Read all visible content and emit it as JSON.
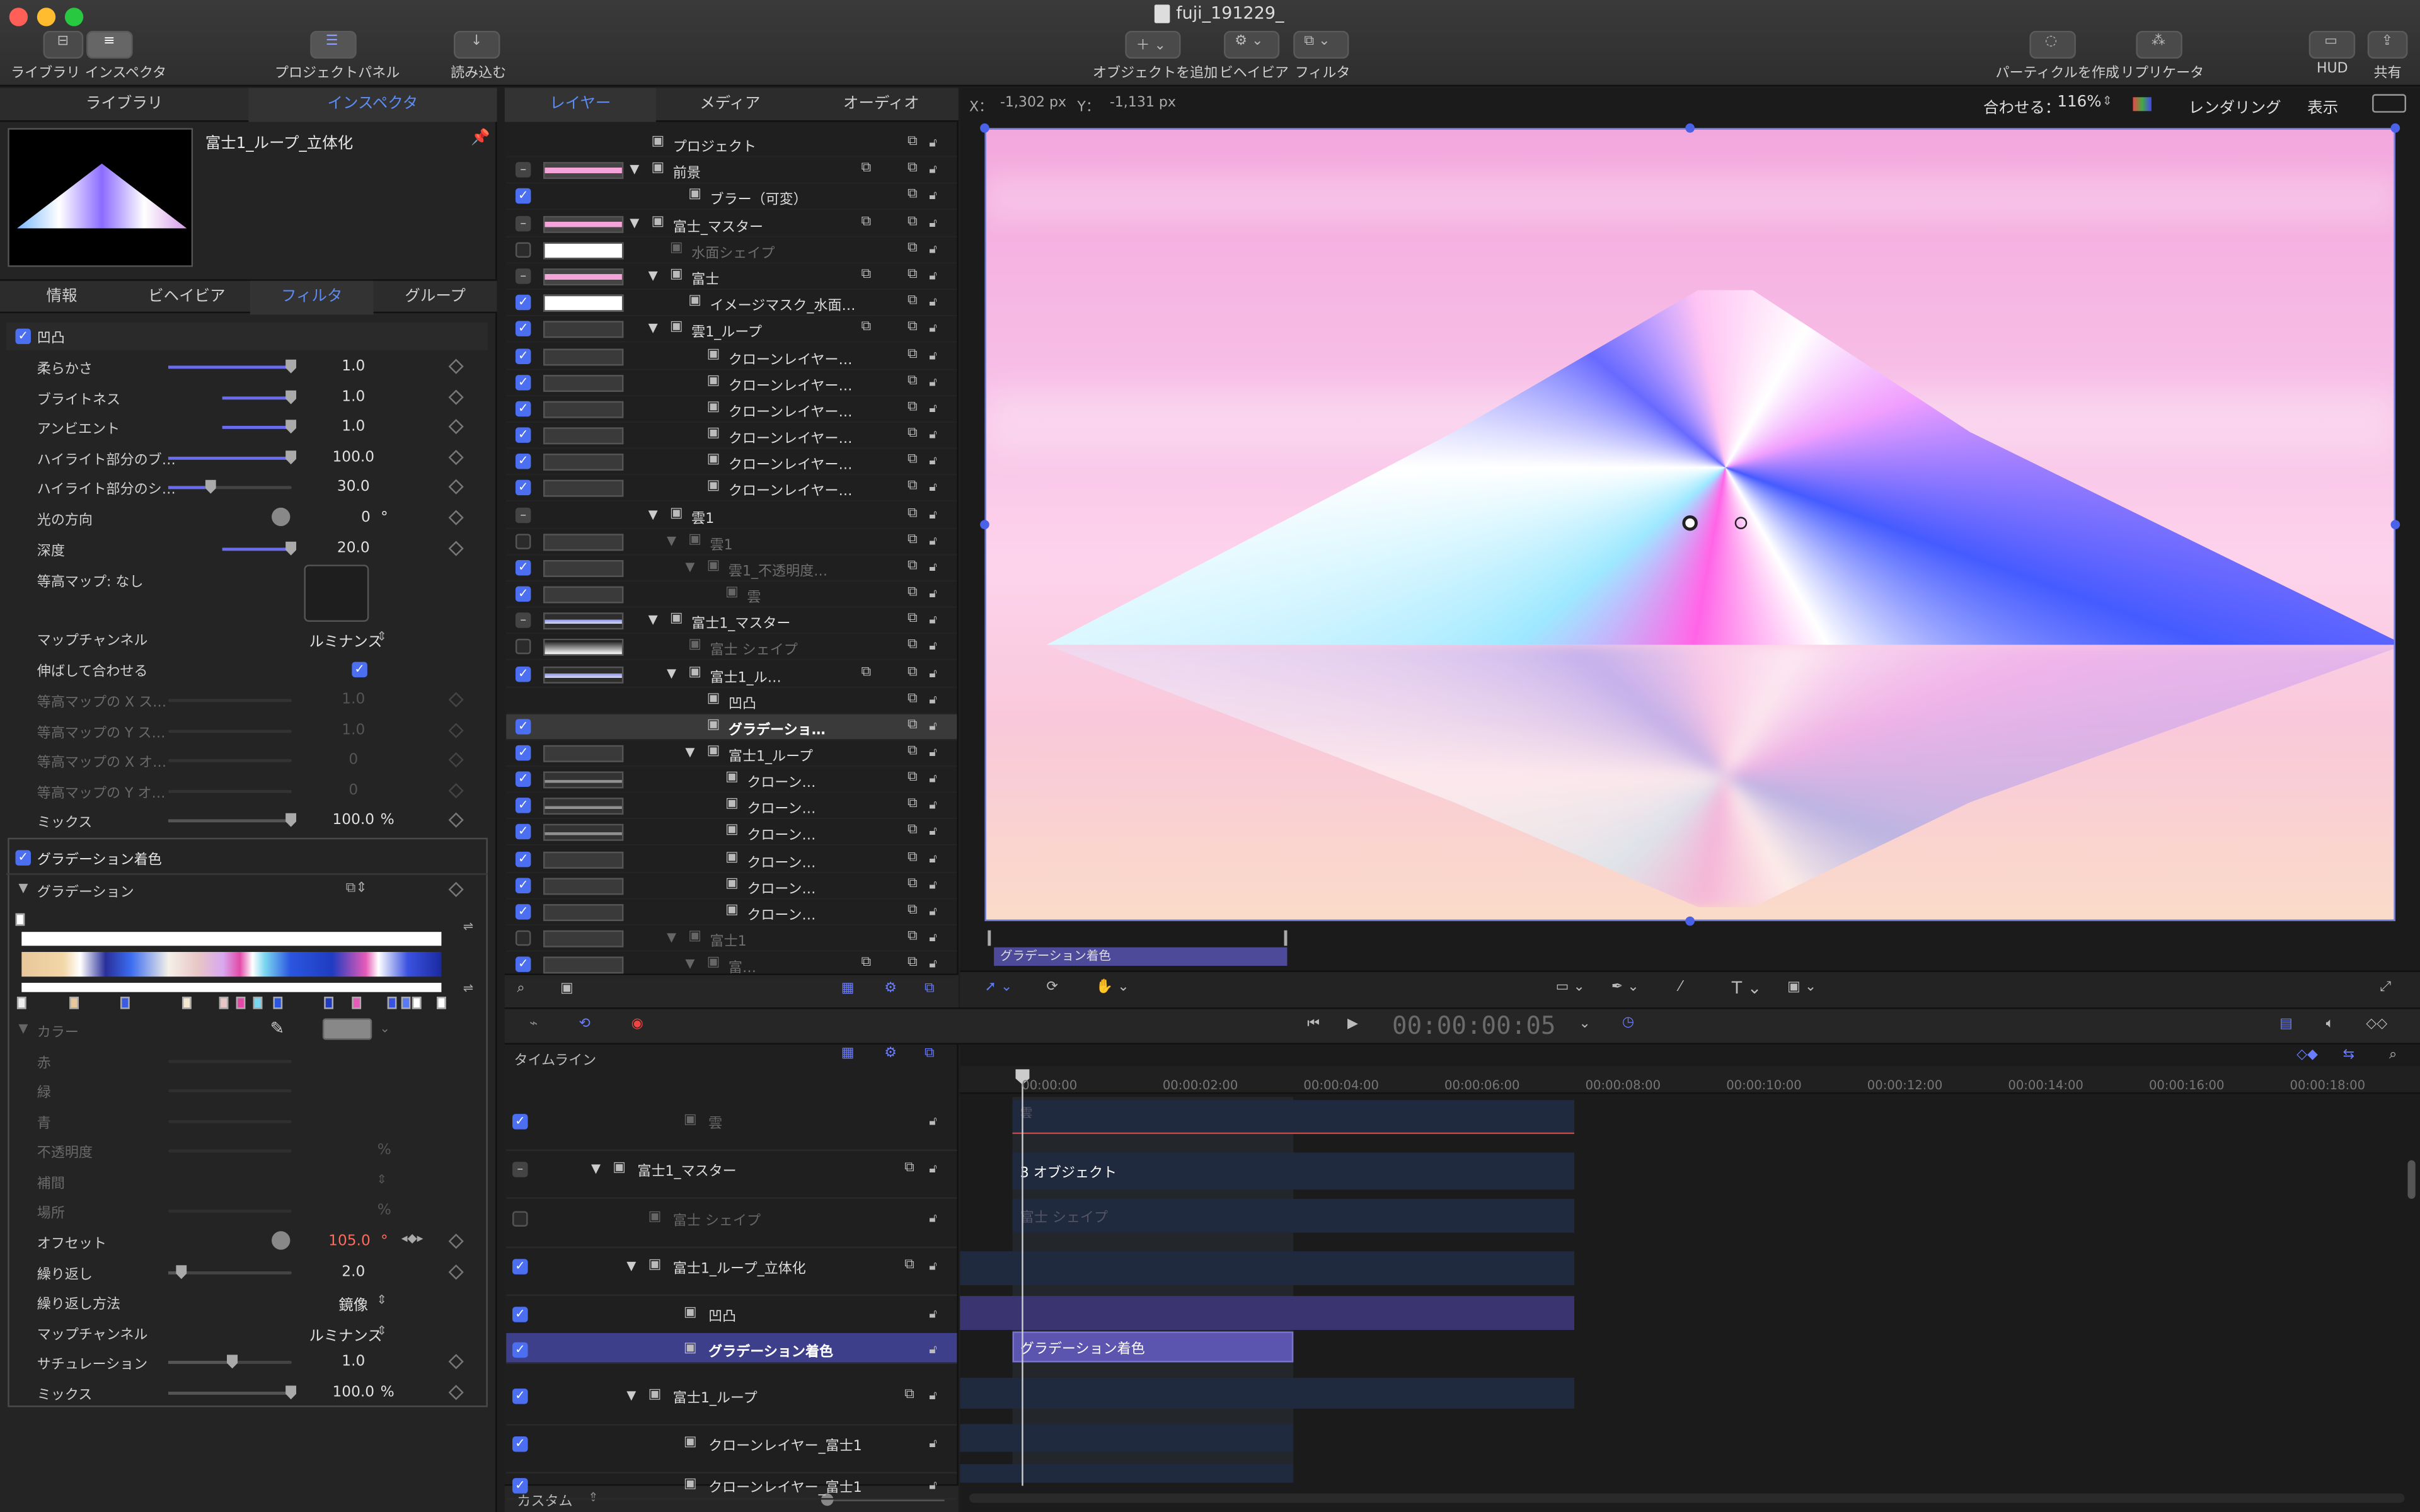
{
  "window": {
    "title": "fuji_191229_"
  },
  "toolbar": {
    "library": "ライブラリ",
    "inspector": "インスペクタ",
    "project_panel": "プロジェクトパネル",
    "import": "読み込む",
    "add_object": "オブジェクトを追加",
    "behaviors": "ビヘイビア",
    "filters": "フィルタ",
    "make_particles": "パーティクルを作成",
    "replicator": "リプリケータ",
    "hud": "HUD",
    "share": "共有"
  },
  "left_tabs": {
    "library": "ライブラリ",
    "inspector": "インスペクタ"
  },
  "preview": {
    "name": "富士1_ループ_立体化"
  },
  "inspector_tabs": [
    "情報",
    "ビヘイビア",
    "フィルタ",
    "グループ"
  ],
  "filter1": {
    "name": "凹凸",
    "params": [
      {
        "label": "柔らかさ",
        "value": "1.0"
      },
      {
        "label": "ブライトネス",
        "value": "1.0"
      },
      {
        "label": "アンビエント",
        "value": "1.0"
      },
      {
        "label": "ハイライト部分のブ…",
        "value": "100.0"
      },
      {
        "label": "ハイライト部分のシ…",
        "value": "30.0"
      },
      {
        "label": "光の方向",
        "value": "0",
        "unit": "°"
      },
      {
        "label": "深度",
        "value": "20.0"
      }
    ],
    "map_label": "等高マップ: なし",
    "map_channel_label": "マップチャンネル",
    "map_channel_value": "ルミナンス",
    "stretch_label": "伸ばして合わせる",
    "dim_params": [
      {
        "label": "等高マップの X ス…",
        "value": "1.0"
      },
      {
        "label": "等高マップの Y ス…",
        "value": "1.0"
      },
      {
        "label": "等高マップの X オ…",
        "value": "0"
      },
      {
        "label": "等高マップの Y オ…",
        "value": "0"
      }
    ],
    "mix_label": "ミックス",
    "mix_value": "100.0",
    "mix_unit": "%"
  },
  "filter2": {
    "name": "グラデーション着色",
    "gradient_label": "グラデーション",
    "color_label": "カラー",
    "dim_params": [
      "赤",
      "緑",
      "青",
      "不透明度",
      "補間",
      "場所"
    ],
    "dim_units": [
      "%",
      "%"
    ],
    "params": [
      {
        "label": "オフセット",
        "value": "105.0",
        "unit": "°"
      },
      {
        "label": "繰り返し",
        "value": "2.0"
      },
      {
        "label": "繰り返し方法",
        "value": "鏡像"
      },
      {
        "label": "マップチャンネル",
        "value": "ルミナンス"
      },
      {
        "label": "サチュレーション",
        "value": "1.0"
      },
      {
        "label": "ミックス",
        "value": "100.0",
        "unit": "%"
      }
    ]
  },
  "layers_tabs": {
    "layers": "レイヤー",
    "media": "メディア",
    "audio": "オーディオ"
  },
  "layers": [
    {
      "name": "プロジェクト"
    },
    {
      "name": "前景"
    },
    {
      "name": "ブラー（可変）"
    },
    {
      "name": "富士_マスター"
    },
    {
      "name": "水面シェイプ"
    },
    {
      "name": "富士"
    },
    {
      "name": "イメージマスク_水面…"
    },
    {
      "name": "雲1_ループ"
    },
    {
      "name": "クローンレイヤー…"
    },
    {
      "name": "クローンレイヤー…"
    },
    {
      "name": "クローンレイヤー…"
    },
    {
      "name": "クローンレイヤー…"
    },
    {
      "name": "クローンレイヤー…"
    },
    {
      "name": "クローンレイヤー…"
    },
    {
      "name": "雲1"
    },
    {
      "name": "雲1"
    },
    {
      "name": "雲1_不透明度…"
    },
    {
      "name": "雲"
    },
    {
      "name": "富士1_マスター"
    },
    {
      "name": "富士 シェイプ"
    },
    {
      "name": "富士1_ル…"
    },
    {
      "name": "凹凸"
    },
    {
      "name": "グラデーショ…"
    },
    {
      "name": "富士1_ループ"
    },
    {
      "name": "クローン…"
    },
    {
      "name": "クローン…"
    },
    {
      "name": "クローン…"
    },
    {
      "name": "クローン…"
    },
    {
      "name": "クローン…"
    },
    {
      "name": "クローン…"
    },
    {
      "name": "富士1"
    },
    {
      "name": "富…"
    }
  ],
  "canvas": {
    "x_label": "X：",
    "x_value": "-1,302 px",
    "y_label": "Y：",
    "y_value": "-1,131 px",
    "fit_label": "合わせる：",
    "zoom": "116%",
    "rendering": "レンダリング",
    "view": "表示",
    "mini_clip": "グラデーション着色"
  },
  "transport": {
    "timecode": "00:00:00:05"
  },
  "timeline": {
    "label": "タイムライン",
    "ticks": [
      "00:00:00",
      "00:00:02:00",
      "00:00:04:00",
      "00:00:06:00",
      "00:00:08:00",
      "00:00:10:00",
      "00:00:12:00",
      "00:00:14:00",
      "00:00:16:00",
      "00:00:18:00"
    ],
    "rows": [
      {
        "name": "雲"
      },
      {
        "name": "富士1_マスター"
      },
      {
        "name": "富士 シェイプ"
      },
      {
        "name": "富士1_ループ_立体化"
      },
      {
        "name": "凹凸"
      },
      {
        "name": "グラデーション着色"
      },
      {
        "name": "富士1_ループ"
      },
      {
        "name": "クローンレイヤー_富士1"
      },
      {
        "name": "クローンレイヤー_富士1"
      }
    ],
    "bars": {
      "objects": "3 オブジェクト",
      "shape": "富士 シェイプ",
      "gradient": "グラデーション着色",
      "cloud": "雲"
    },
    "custom": "カスタム"
  }
}
